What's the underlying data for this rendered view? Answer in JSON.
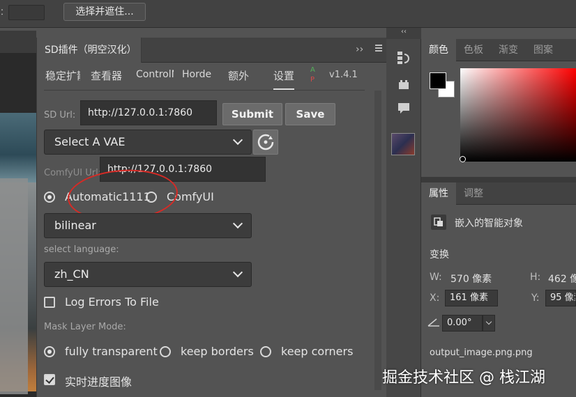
{
  "options_bar": {
    "label_suffix": "：",
    "select_and_mask_label": "选择并遮住..."
  },
  "plugin_panel": {
    "title": "SD插件（明空汉化）",
    "collapse_glyph": "››",
    "tabs": [
      "稳定扩散",
      "查看器",
      "ControlNet",
      "Horde",
      "额外",
      "设置"
    ],
    "active_tab": "设置",
    "badge_a": "A",
    "badge_p": "P",
    "version": "v1.4.1",
    "sd_url_label": "SD Url:",
    "sd_url_value": "http://127.0.0.1:7860",
    "submit_label": "Submit",
    "save_label": "Save",
    "vae_select": "Select A VAE",
    "comfyui_url_label": "ComfyUI Url:",
    "comfyui_url_value": "http://127.0.0.1:7860",
    "backend_options": [
      "Automatic1111",
      "ComfyUI"
    ],
    "backend_selected": "Automatic1111",
    "sampler_select": "bilinear",
    "select_language_label": "select language:",
    "language_select": "zh_CN",
    "log_errors_label": "Log Errors To File",
    "log_errors_checked": false,
    "mask_layer_mode_label": "Mask Layer Mode:",
    "mask_modes": [
      "fully transparent",
      "keep borders",
      "keep corners"
    ],
    "mask_mode_selected": "fully transparent",
    "realtime_preview_label": "实时进度图像",
    "realtime_preview_checked": true,
    "annotation_color": "#d72a25"
  },
  "tool_strip": {
    "collapse_glyph": "‹‹"
  },
  "color_panel": {
    "tabs": [
      "颜色",
      "色板",
      "渐变",
      "图案"
    ],
    "active_tab": "颜色",
    "foreground_color": "#000000",
    "background_color": "#ffffff"
  },
  "properties_panel": {
    "tabs": [
      "属性",
      "调整"
    ],
    "active_tab": "属性",
    "object_type": "嵌入的智能对象",
    "transform_label": "变换",
    "w_label": "W:",
    "w_value": "570 像素",
    "h_label": "H:",
    "h_value": "462 像素",
    "x_label": "X:",
    "x_value": "161 像素",
    "y_label": "Y:",
    "y_value": "95 像素",
    "angle_value": "0.00°",
    "filename": "output_image.png.png"
  },
  "watermark": "掘金技术社区 @ 栈江湖"
}
